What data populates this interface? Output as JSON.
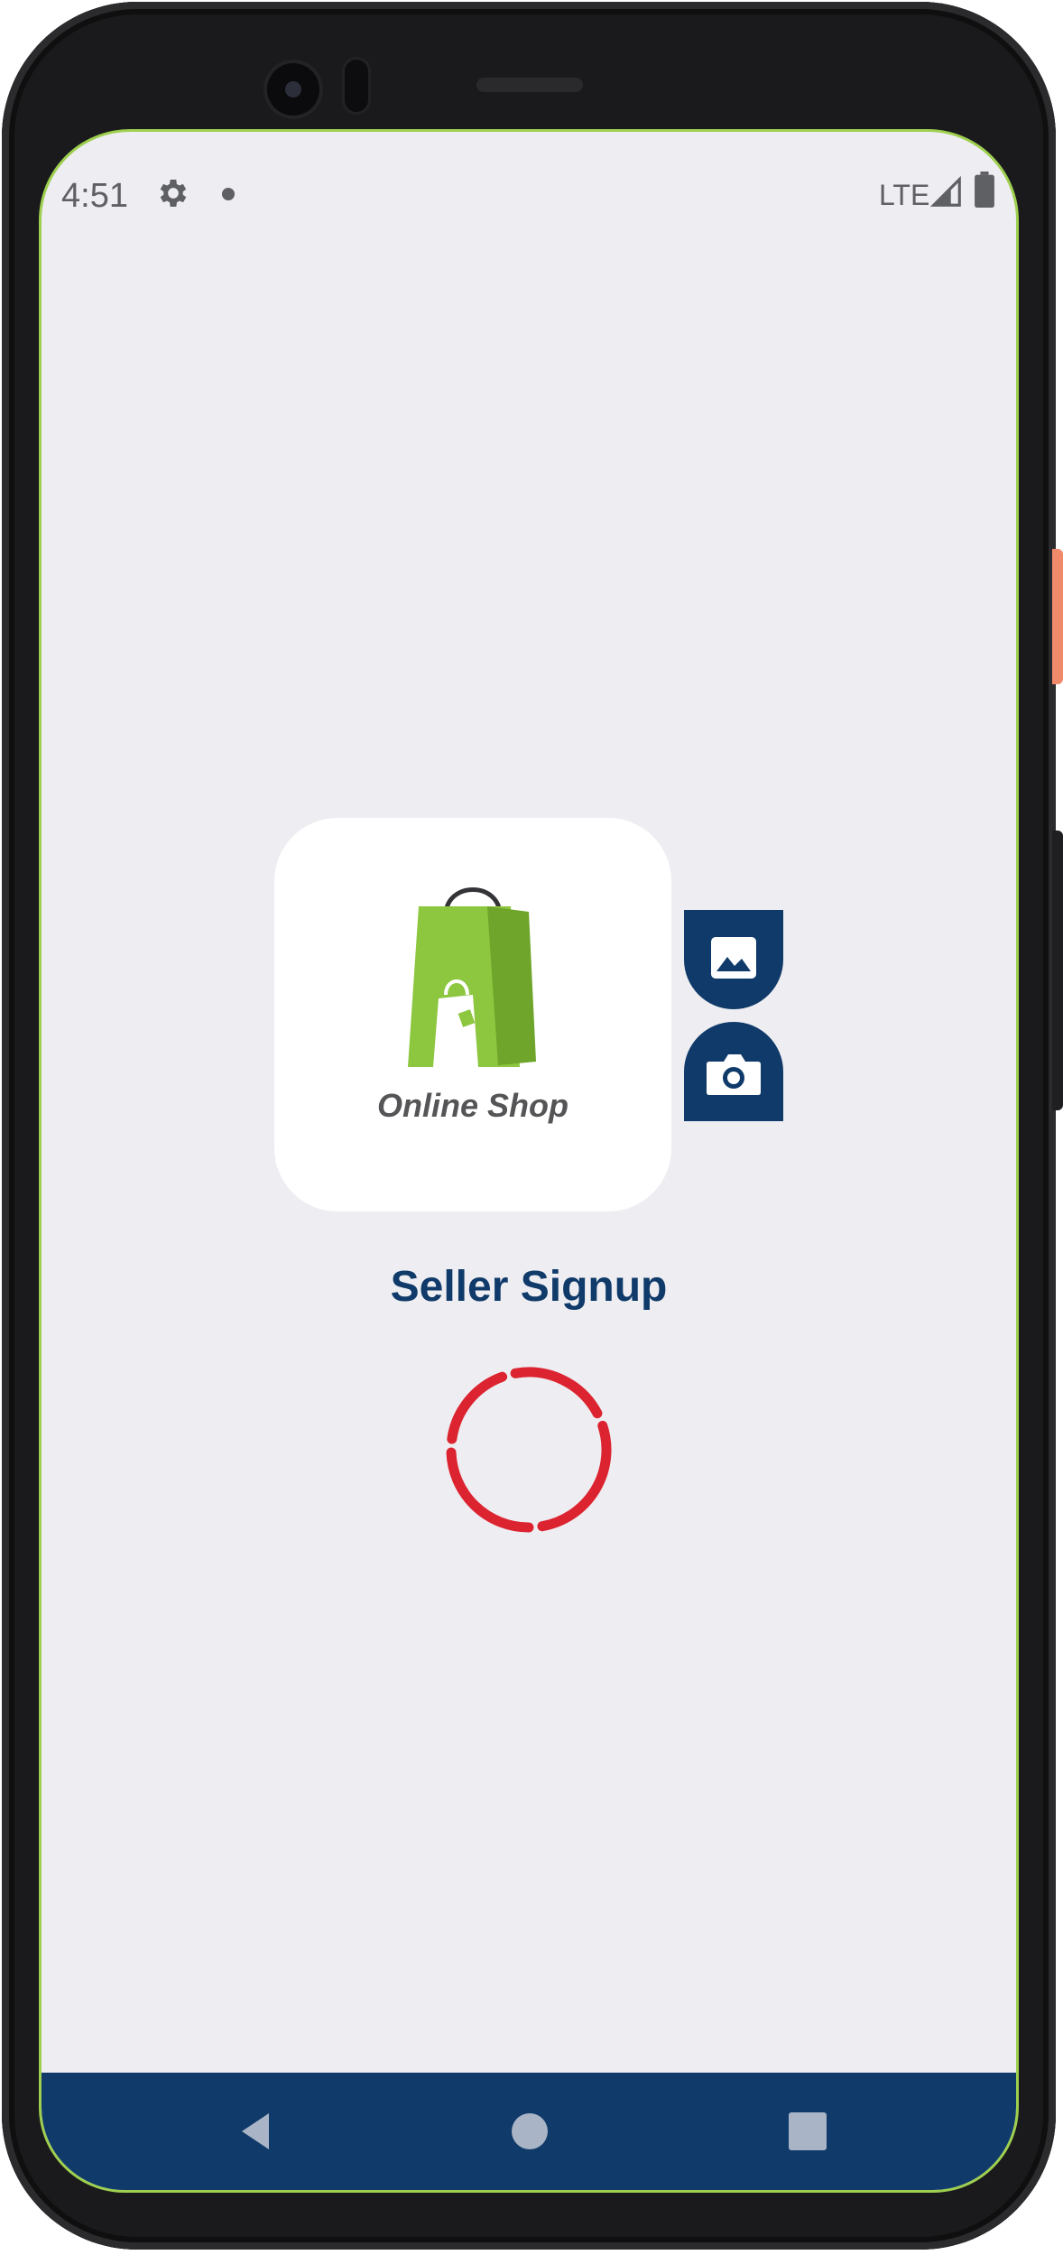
{
  "status_bar": {
    "time": "4:51",
    "network": "LTE",
    "icons": [
      "gear-icon",
      "notification-dot-icon",
      "signal-icon",
      "battery-icon"
    ]
  },
  "logo": {
    "brand_text": "Online Shop",
    "bag_color_light": "#8dc63f",
    "bag_color_dark": "#6ea52a"
  },
  "actions": {
    "gallery_icon": "image-icon",
    "camera_icon": "camera-icon"
  },
  "page": {
    "title": "Seller Signup"
  },
  "loading": {
    "spinner_color": "#dc2430"
  },
  "navigation": {
    "buttons": [
      "back-icon",
      "home-icon",
      "recents-icon"
    ]
  },
  "colors": {
    "primary": "#0f3a69",
    "background": "#eeedf2",
    "accent_green": "#8dc63f"
  }
}
